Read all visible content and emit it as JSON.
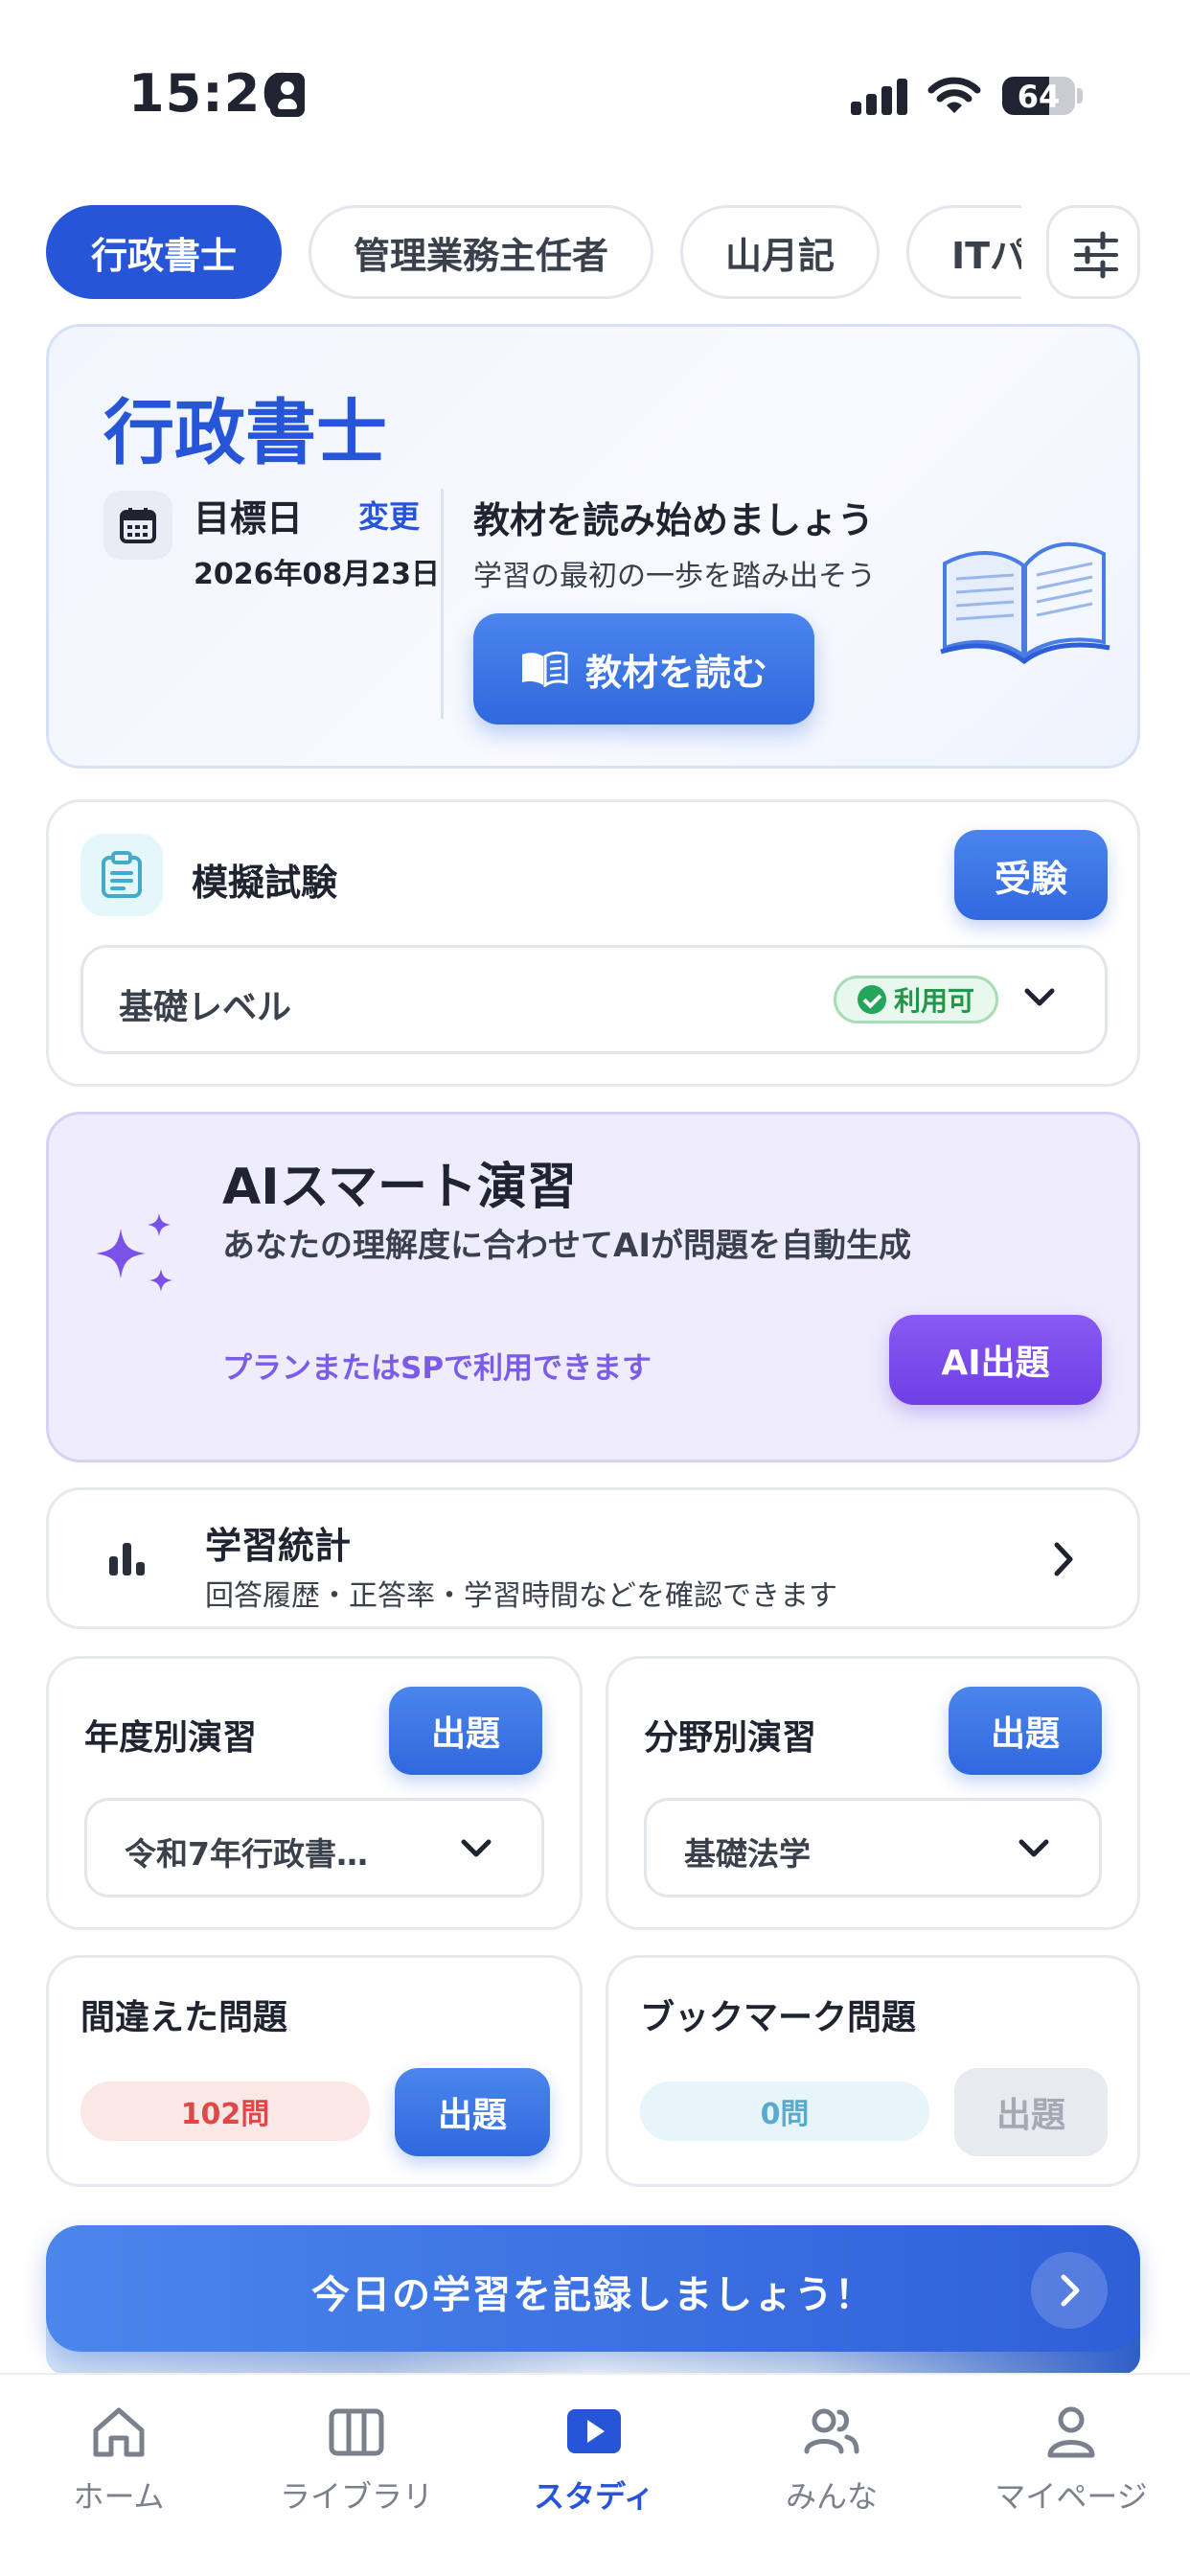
{
  "status_bar": {
    "time": "15:26",
    "battery": "64",
    "battery_level": 0.64
  },
  "tabs": [
    {
      "label": "行政書士",
      "active": true
    },
    {
      "label": "管理業務主任者",
      "active": false
    },
    {
      "label": "山月記",
      "active": false
    },
    {
      "label": "ITパ",
      "active": false
    }
  ],
  "hero": {
    "title": "行政書士",
    "target_label": "目標日",
    "change_label": "変更",
    "target_date": "2026年08月23日",
    "heading": "教材を読み始めましょう",
    "subtext": "学習の最初の一歩を踏み出そう",
    "read_button": "教材を読む"
  },
  "mock_exam": {
    "title": "模擬試験",
    "button": "受験",
    "level": "基礎レベル",
    "badge": "利用可"
  },
  "ai_practice": {
    "title": "AIスマート演習",
    "subtitle": "あなたの理解度に合わせてAIが問題を自動生成",
    "note": "プランまたはSPで利用できます",
    "button": "AI出題"
  },
  "stats": {
    "title": "学習統計",
    "subtitle": "回答履歴・正答率・学習時間などを確認できます"
  },
  "yearly": {
    "title": "年度別演習",
    "button": "出題",
    "select": "令和7年行政書…"
  },
  "field": {
    "title": "分野別演習",
    "button": "出題",
    "select": "基礎法学"
  },
  "wrong": {
    "title": "間違えた問題",
    "count": "102問",
    "button": "出題"
  },
  "bookmark": {
    "title": "ブックマーク問題",
    "count": "0問",
    "button": "出題"
  },
  "banner": {
    "text": "今日の学習を記録しましょう！"
  },
  "tabbar": [
    {
      "label": "ホーム",
      "icon": "home-icon",
      "active": false
    },
    {
      "label": "ライブラリ",
      "icon": "library-icon",
      "active": false
    },
    {
      "label": "スタディ",
      "icon": "play-icon",
      "active": true
    },
    {
      "label": "みんな",
      "icon": "people-icon",
      "active": false
    },
    {
      "label": "マイページ",
      "icon": "person-icon",
      "active": false
    }
  ],
  "colors": {
    "primary": "#2755d8",
    "ai_purple": "#6f3fe6",
    "success": "#23964a",
    "danger": "#e04848",
    "info": "#5aa9cf"
  }
}
